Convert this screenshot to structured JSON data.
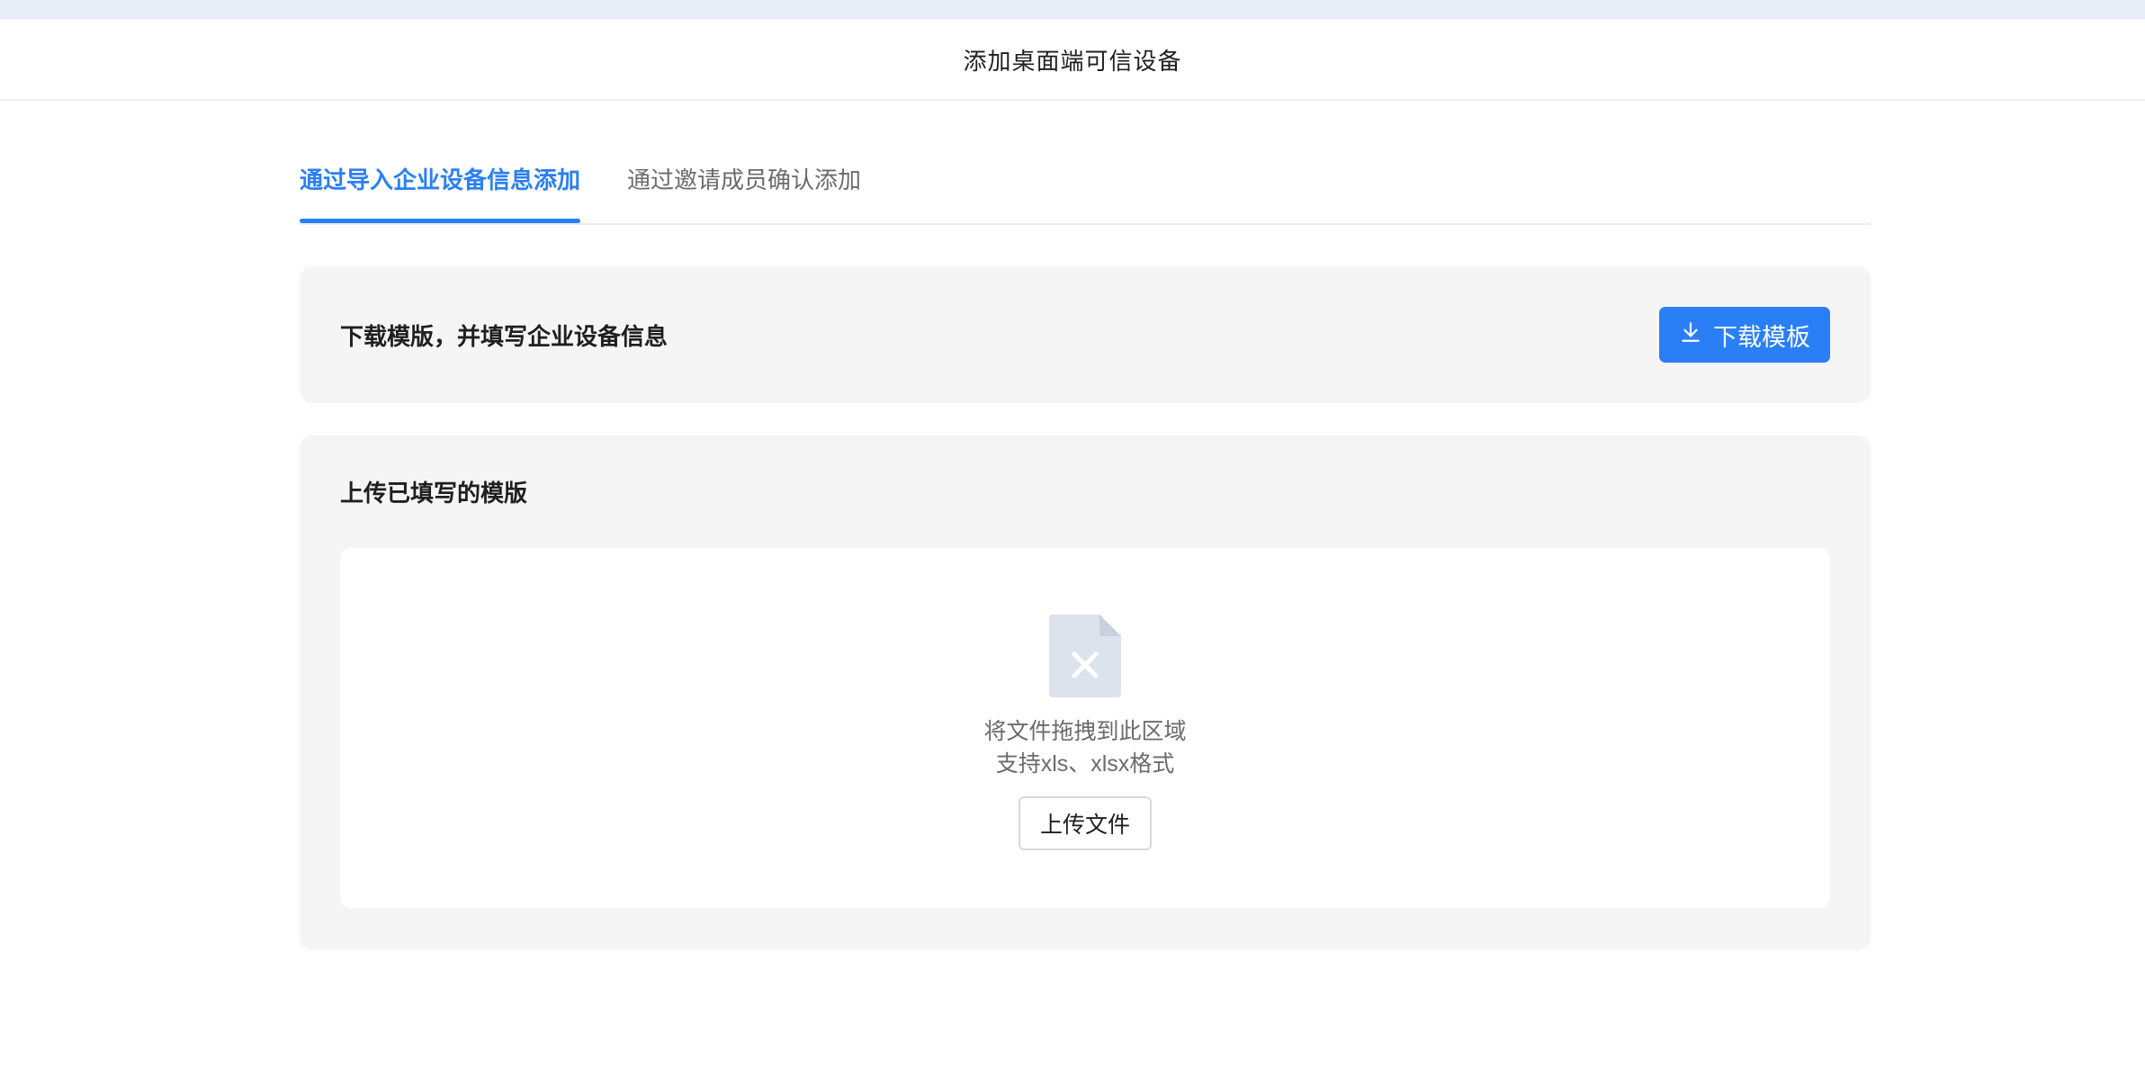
{
  "header": {
    "title": "添加桌面端可信设备"
  },
  "tabs": [
    {
      "label": "通过导入企业设备信息添加",
      "active": true
    },
    {
      "label": "通过邀请成员确认添加",
      "active": false
    }
  ],
  "download_section": {
    "title": "下载模版，并填写企业设备信息",
    "button_label": "下载模板",
    "button_icon": "download-icon"
  },
  "upload_section": {
    "title": "上传已填写的模版",
    "file_icon": "file-excel-icon",
    "hint_line1": "将文件拖拽到此区域",
    "hint_line2": "支持xls、xlsx格式",
    "button_label": "上传文件"
  },
  "colors": {
    "accent": "#2b7ff6",
    "card_background": "#f5f5f5",
    "top_band": "#e8ecf6"
  }
}
